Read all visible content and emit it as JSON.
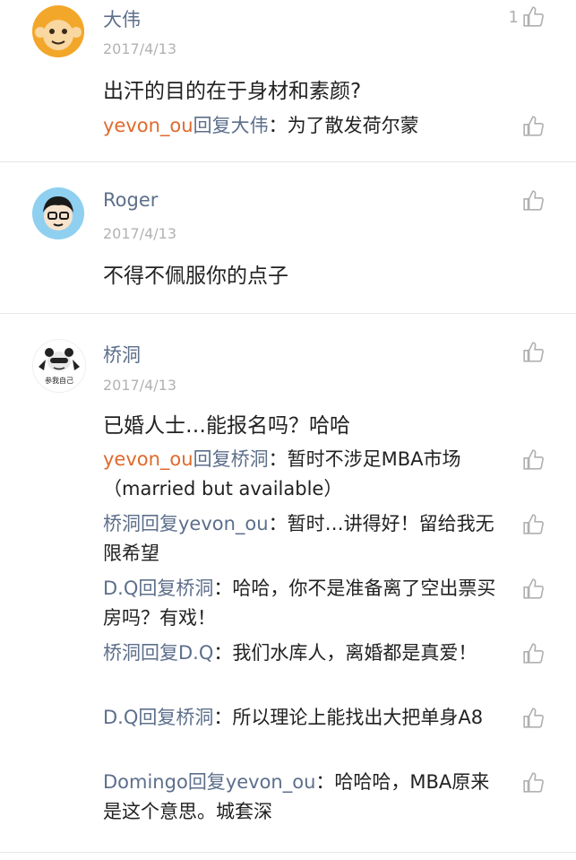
{
  "comments": [
    {
      "name": "大伟",
      "date": "2017/4/13",
      "content": "出汗的目的在于身材和素颜?",
      "likes": "1",
      "replies": [
        {
          "from": "yevon_ou",
          "verb": "回复",
          "to": "大伟",
          "text": "：为了散发荷尔蒙"
        }
      ]
    },
    {
      "name": "Roger",
      "date": "2017/4/13",
      "content": "不得不佩服你的点子",
      "likes": "",
      "replies": []
    },
    {
      "name": "桥洞",
      "date": "2017/4/13",
      "content": "已婚人士…能报名吗？哈哈",
      "likes": "",
      "avatar_caption": "参我自己",
      "replies": [
        {
          "from": "yevon_ou",
          "verb": "回复",
          "to": "桥洞",
          "text": "：暂时不涉足MBA市场（married but available）"
        },
        {
          "from": "桥洞",
          "verb": "回复",
          "to": "yevon_ou",
          "text": "：暂时…讲得好！留给我无限希望"
        },
        {
          "from": "D.Q",
          "verb": "回复",
          "to": "桥洞",
          "text": "：哈哈，你不是准备离了空出票买房吗？有戏！"
        },
        {
          "from": "桥洞",
          "verb": "回复",
          "to": "D.Q",
          "text": "：我们水库人，离婚都是真爱！"
        },
        {
          "from": "D.Q",
          "verb": "回复",
          "to": "桥洞",
          "text": "：所以理论上能找出大把单身A8"
        },
        {
          "from": "Domingo",
          "verb": "回复",
          "to": "yevon_ou",
          "text": "：哈哈哈，MBA原来是这个意思。城套深"
        }
      ]
    }
  ],
  "icons": {
    "like": "thumbs-up-icon"
  },
  "colors": {
    "name": "#5d6f8b",
    "highlight_user": "#e06a2b",
    "date": "#b2b2b2",
    "divider": "#e6e6e6"
  }
}
